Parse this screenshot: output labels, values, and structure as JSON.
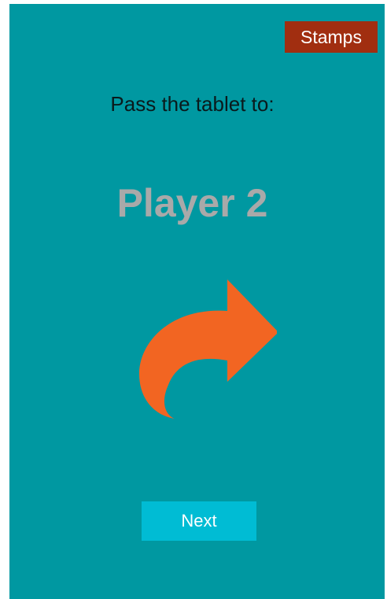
{
  "header": {
    "stamps_label": "Stamps"
  },
  "main": {
    "prompt": "Pass the tablet to:",
    "player_name": "Player 2",
    "arrow_icon": "share-forward-arrow-icon"
  },
  "footer": {
    "next_label": "Next"
  },
  "colors": {
    "background": "#0098a1",
    "stamps_button": "#a12e10",
    "arrow": "#f26522",
    "player_name": "#a9a9a9",
    "next_button": "#00bcd4"
  }
}
